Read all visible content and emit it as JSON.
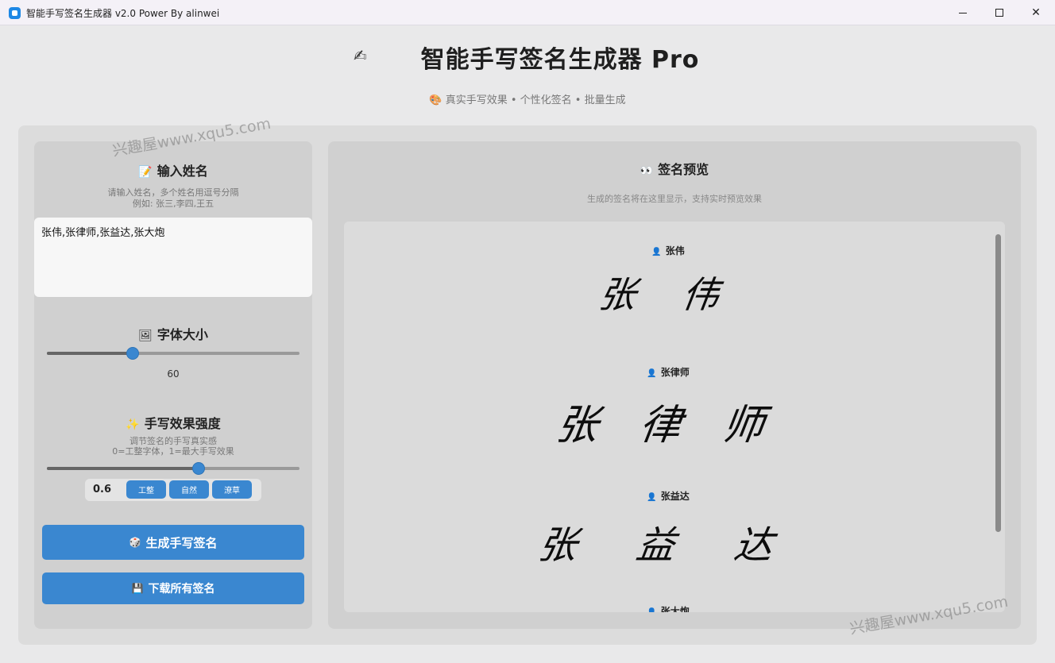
{
  "window": {
    "title": "智能手写签名生成器 v2.0 Power By alinwei",
    "minimize_glyph": "",
    "close_glyph": "✕"
  },
  "header": {
    "icon": "✍",
    "title": "智能手写签名生成器 Pro",
    "subtitle": "🎨 真实手写效果 • 个性化签名 • 批量生成"
  },
  "input_section": {
    "icon": "📝",
    "title": "输入姓名",
    "hint_line1": "请输入姓名，多个姓名用逗号分隔",
    "hint_line2": "例如: 张三,李四,王五",
    "value": "张伟,张律师,张益达,张大炮"
  },
  "font_size": {
    "icon": "🖼",
    "title": "字体大小",
    "value": "60",
    "slider_fraction": 0.34
  },
  "intensity": {
    "icon": "✨",
    "title": "手写效果强度",
    "hint_line1": "调节签名的手写真实感",
    "hint_line2": "0=工整字体，1=最大手写效果",
    "value": "0.6",
    "slider_fraction": 0.6,
    "presets": [
      "工整",
      "自然",
      "潦草"
    ]
  },
  "actions": {
    "generate_icon": "🎲",
    "generate_label": "生成手写签名",
    "download_icon": "💾",
    "download_label": "下载所有签名"
  },
  "preview": {
    "icon": "👀",
    "title": "签名预览",
    "hint": "生成的签名将在这里显示，支持实时预览效果",
    "person_icon": "👤",
    "signatures": [
      {
        "name": "张伟",
        "script": "张 伟"
      },
      {
        "name": "张律师",
        "script": "张 律 师"
      },
      {
        "name": "张益达",
        "script": "张 益 达"
      },
      {
        "name": "张大炮",
        "script": ""
      }
    ]
  },
  "watermark": "兴趣屋www.xqu5.com",
  "colors": {
    "accent": "#3a87d0",
    "panel": "#d0d0d0",
    "background": "#e9e9ea"
  }
}
